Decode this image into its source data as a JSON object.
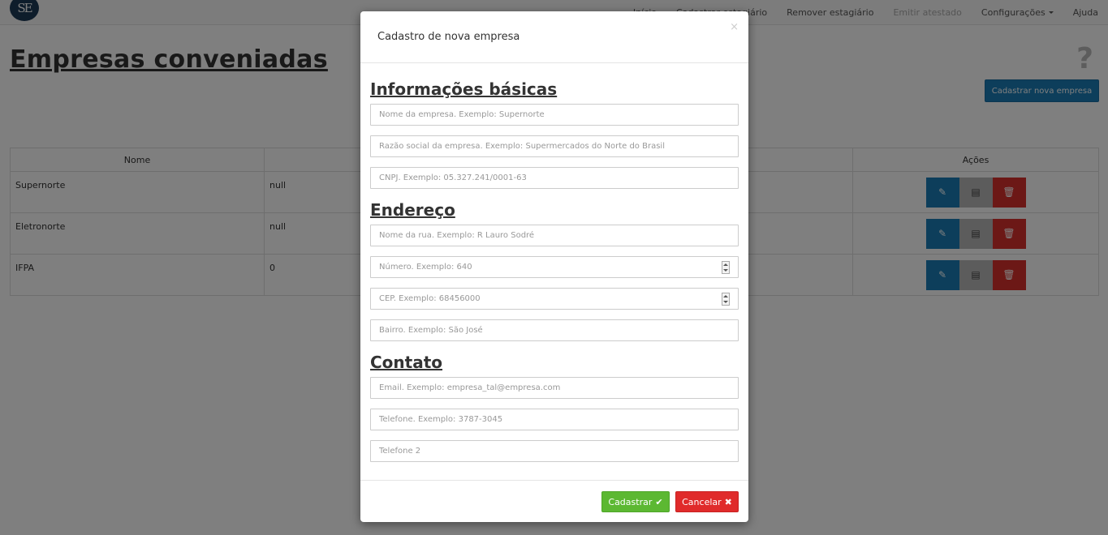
{
  "navbar": {
    "logo": "SE",
    "items": [
      {
        "label": "Início",
        "disabled": false
      },
      {
        "label": "Cadastrar estagiário",
        "disabled": false
      },
      {
        "label": "Remover estagiário",
        "disabled": false
      },
      {
        "label": "Emitir atestado",
        "disabled": true
      },
      {
        "label": "Configurações",
        "disabled": false,
        "dropdown": true
      },
      {
        "label": "Ajuda",
        "disabled": false
      }
    ]
  },
  "page": {
    "title": "Empresas conveniadas",
    "help_icon": "?",
    "new_company_button": "Cadastrar nova empresa"
  },
  "table": {
    "headers": [
      "Nome",
      "Telefone",
      "",
      "Ações"
    ],
    "rows": [
      {
        "nome": "Supernorte",
        "telefone": "null"
      },
      {
        "nome": "Eletronorte",
        "telefone": "null"
      },
      {
        "nome": "IFPA",
        "telefone": "0"
      }
    ],
    "action_icons": [
      "edit-icon",
      "view-icon",
      "trash-icon"
    ]
  },
  "modal": {
    "title": "Cadastro de nova empresa",
    "close_icon": "×",
    "sections": {
      "basic": "Informações básicas",
      "address": "Endereço",
      "contact": "Contato"
    },
    "fields": {
      "nome": "Nome da empresa. Exemplo: Supernorte",
      "razao_social": "Razão social da empresa. Exemplo: Supermercados do Norte do Brasil",
      "cnpj": "CNPJ. Exemplo: 05.327.241/0001-63",
      "rua": "Nome da rua. Exemplo: R Lauro Sodré",
      "numero": "Número. Exemplo: 640",
      "cep": "CEP. Exemplo: 68456000",
      "bairro": "Bairro. Exemplo: São José",
      "email": "Email. Exemplo: empresa_tal@empresa.com",
      "telefone": "Telefone. Exemplo: 3787-3045",
      "telefone2": "Telefone 2"
    },
    "submit_label": "Cadastrar",
    "submit_icon": "✔",
    "cancel_label": "Cancelar",
    "cancel_icon": "✖"
  },
  "colors": {
    "primary": "#1a7db6",
    "success": "#5cb832",
    "danger": "#e02b2b"
  }
}
